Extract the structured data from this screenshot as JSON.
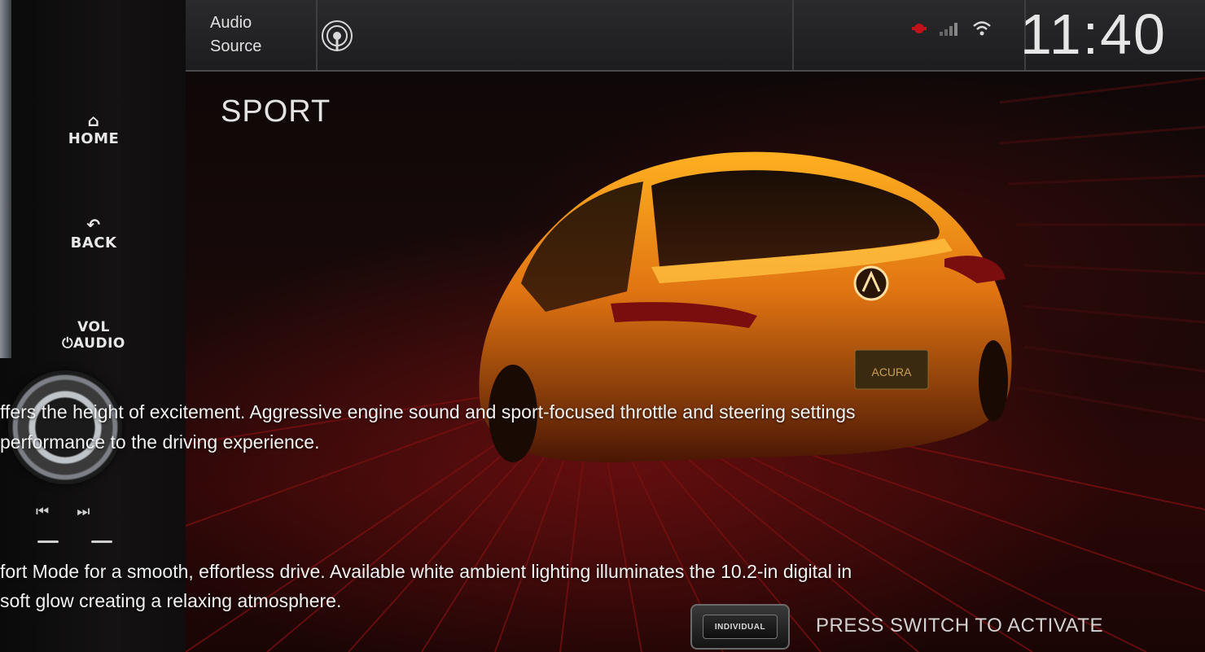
{
  "topbar": {
    "audio_source_line1": "Audio",
    "audio_source_line2": "Source",
    "clock": "11:40"
  },
  "bezel": {
    "home_label": "HOME",
    "back_label": "BACK",
    "vol_label_line1": "VOL",
    "vol_label_line2": "⏻AUDIO"
  },
  "screen": {
    "mode_title": "SPORT"
  },
  "descriptions": [
    "ffers the height of excitement. Aggressive engine sound and sport-focused throttle and steering settings",
    "performance to the driving experience.",
    "fort Mode for a smooth, effortless drive. Available white ambient lighting illuminates the 10.2-in digital in",
    "soft glow creating a relaxing atmosphere."
  ],
  "switch": {
    "label": "INDIVIDUAL",
    "instruction": "PRESS SWITCH TO ACTIVATE"
  },
  "icons": {
    "home": "home-icon",
    "back": "back-arrow-icon",
    "radio": "radio-antenna-icon",
    "prev": "previous-track-icon",
    "next": "next-track-icon"
  },
  "colors": {
    "accent_red": "#c0141a",
    "car_orange": "#e87a10"
  }
}
